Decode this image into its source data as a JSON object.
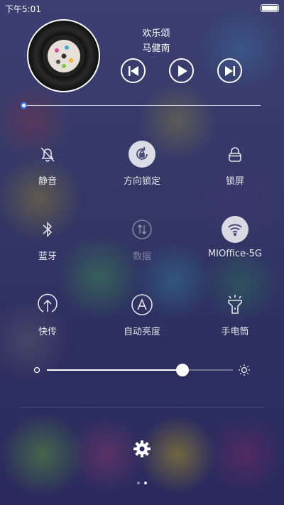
{
  "status_bar": {
    "time": "下午5:01",
    "battery_icon": "battery-icon"
  },
  "music": {
    "title": "欢乐颂",
    "artist": "马健南",
    "controls": [
      "previous-icon",
      "play-icon",
      "next-icon"
    ],
    "progress": 0.01
  },
  "toggles": [
    {
      "label": "静音",
      "icon": "bell-off-icon",
      "active": false,
      "dim": false
    },
    {
      "label": "方向锁定",
      "icon": "rotation-lock-icon",
      "active": true,
      "dim": false
    },
    {
      "label": "锁屏",
      "icon": "lock-icon",
      "active": false,
      "dim": false
    },
    {
      "label": "蓝牙",
      "icon": "bluetooth-icon",
      "active": false,
      "dim": false
    },
    {
      "label": "数据",
      "icon": "data-icon",
      "active": false,
      "dim": true
    },
    {
      "label": "MIOffice-5G",
      "icon": "wifi-icon",
      "active": true,
      "dim": false
    },
    {
      "label": "快传",
      "icon": "transfer-icon",
      "active": false,
      "dim": false
    },
    {
      "label": "自动亮度",
      "icon": "auto-brightness-icon",
      "active": false,
      "dim": false
    },
    {
      "label": "手电筒",
      "icon": "flashlight-icon",
      "active": false,
      "dim": false
    }
  ],
  "brightness": {
    "level": 0.73,
    "low_icon": "brightness-low-icon",
    "high_icon": "brightness-high-icon"
  },
  "footer": {
    "settings_icon": "gear-icon",
    "pages": 2,
    "current_page": 2
  },
  "colors": {
    "accent": "#3a78ff",
    "active_tile": "#ffffff"
  }
}
